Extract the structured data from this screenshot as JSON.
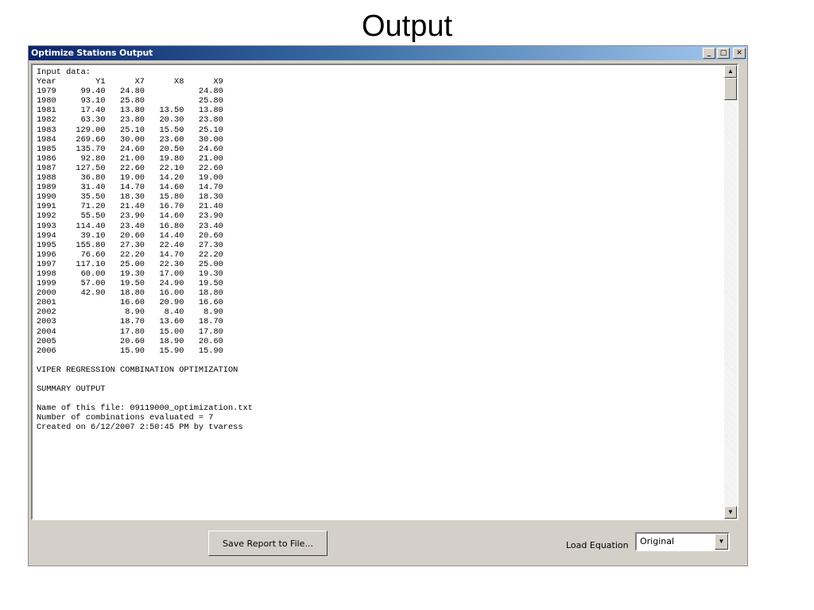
{
  "slide": {
    "title": "Output"
  },
  "window": {
    "title": "Optimize Stations Output",
    "minimize_glyph": "_",
    "maximize_glyph": "□",
    "close_glyph": "✕"
  },
  "report": {
    "lines": [
      "Input data:",
      "Year        Y1      X7      X8      X9",
      "1979     99.40   24.80           24.80",
      "1980     93.10   25.80           25.80",
      "1981     17.40   13.80   13.50   13.80",
      "1982     63.30   23.80   20.30   23.80",
      "1983    129.00   25.10   15.50   25.10",
      "1984    269.60   30.00   23.60   30.00",
      "1985    135.70   24.60   20.50   24.60",
      "1986     92.80   21.00   19.80   21.00",
      "1987    127.50   22.60   22.10   22.60",
      "1988     36.80   19.00   14.20   19.00",
      "1989     31.40   14.70   14.60   14.70",
      "1990     35.50   18.30   15.80   18.30",
      "1991     71.20   21.40   16.70   21.40",
      "1992     55.50   23.90   14.60   23.90",
      "1993    114.40   23.40   16.80   23.40",
      "1994     39.10   20.60   14.40   20.60",
      "1995    155.80   27.30   22.40   27.30",
      "1996     76.60   22.20   14.70   22.20",
      "1997    117.10   25.00   22.30   25.00",
      "1998     60.00   19.30   17.00   19.30",
      "1999     57.00   19.50   24.90   19.50",
      "2000     42.90   18.80   16.00   18.80",
      "2001             16.60   20.90   16.60",
      "2002              8.90    8.40    8.90",
      "2003             18.70   13.60   18.70",
      "2004             17.80   15.00   17.80",
      "2005             20.60   18.90   20.60",
      "2006             15.90   15.90   15.90",
      "",
      "VIPER REGRESSION COMBINATION OPTIMIZATION",
      "",
      "SUMMARY OUTPUT",
      "",
      "Name of this file: 09119000_optimization.txt",
      "Number of combinations evaluated = 7",
      "Created on 6/12/2007 2:50:45 PM by tvaress"
    ]
  },
  "scrollbar": {
    "up_glyph": "▲",
    "down_glyph": "▼"
  },
  "footer": {
    "save_label": "Save Report to File...",
    "load_label": "Load Equation",
    "load_selected": "Original",
    "dropdown_glyph": "▼"
  }
}
